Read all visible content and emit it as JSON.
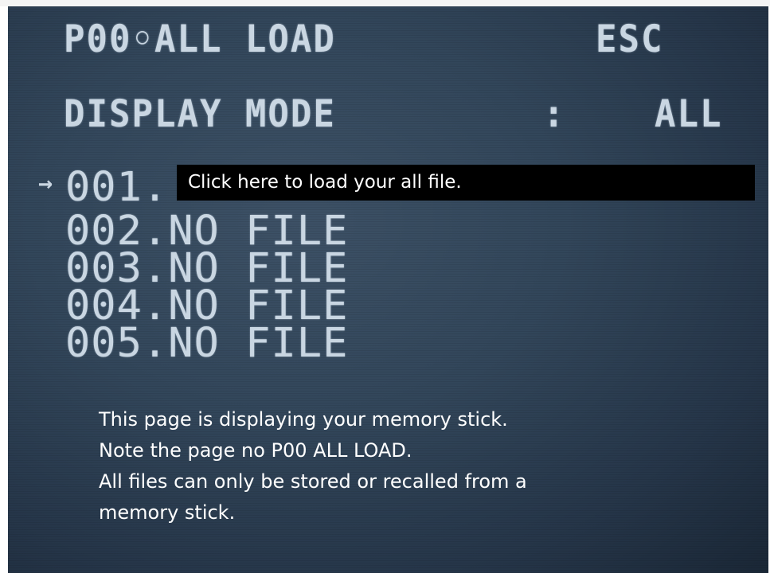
{
  "header": {
    "title": "P00◦ALL LOAD",
    "esc_label": "ESC"
  },
  "display_mode": {
    "label": "DISPLAY MODE",
    "separator": ":",
    "value": "ALL"
  },
  "file_list": {
    "selection_arrow": "→",
    "items": [
      {
        "label": "001."
      },
      {
        "label": "002.NO FILE"
      },
      {
        "label": "003.NO FILE"
      },
      {
        "label": "004.NO FILE"
      },
      {
        "label": "005.NO FILE"
      }
    ]
  },
  "tooltip": {
    "text": "Click here to load your all file."
  },
  "caption": {
    "lines": [
      "This page is displaying your memory stick.",
      "Note the page no P00 ALL LOAD.",
      "All files can only be stored or recalled from a",
      "memory stick."
    ]
  }
}
